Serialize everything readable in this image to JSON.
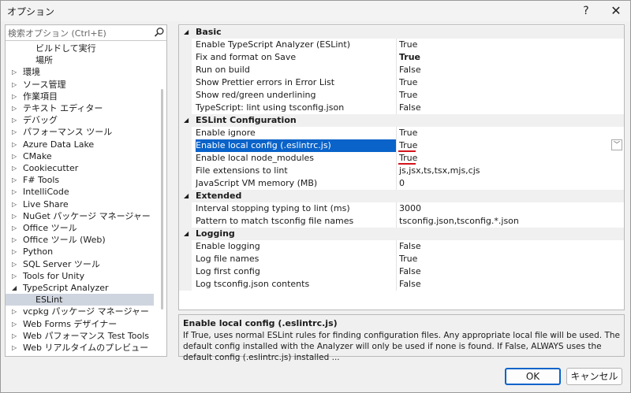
{
  "window": {
    "title": "オプション",
    "help_glyph": "?",
    "close_glyph": "✕"
  },
  "search": {
    "placeholder": "検索オプション (Ctrl+E)"
  },
  "tree": {
    "items": [
      {
        "label": "ビルドして実行",
        "level": 2,
        "expandable": false
      },
      {
        "label": "場所",
        "level": 2,
        "expandable": false
      },
      {
        "label": "環境",
        "level": 1,
        "expandable": true
      },
      {
        "label": "ソース管理",
        "level": 1,
        "expandable": true
      },
      {
        "label": "作業項目",
        "level": 1,
        "expandable": true
      },
      {
        "label": "テキスト エディター",
        "level": 1,
        "expandable": true
      },
      {
        "label": "デバッグ",
        "level": 1,
        "expandable": true
      },
      {
        "label": "パフォーマンス ツール",
        "level": 1,
        "expandable": true
      },
      {
        "label": "Azure Data Lake",
        "level": 1,
        "expandable": true
      },
      {
        "label": "CMake",
        "level": 1,
        "expandable": true
      },
      {
        "label": "Cookiecutter",
        "level": 1,
        "expandable": true
      },
      {
        "label": "F# Tools",
        "level": 1,
        "expandable": true
      },
      {
        "label": "IntelliCode",
        "level": 1,
        "expandable": true
      },
      {
        "label": "Live Share",
        "level": 1,
        "expandable": true
      },
      {
        "label": "NuGet パッケージ マネージャー",
        "level": 1,
        "expandable": true
      },
      {
        "label": "Office ツール",
        "level": 1,
        "expandable": true
      },
      {
        "label": "Office ツール (Web)",
        "level": 1,
        "expandable": true
      },
      {
        "label": "Python",
        "level": 1,
        "expandable": true
      },
      {
        "label": "SQL Server ツール",
        "level": 1,
        "expandable": true
      },
      {
        "label": "Tools for Unity",
        "level": 1,
        "expandable": true
      },
      {
        "label": "TypeScript Analyzer",
        "level": 1,
        "expandable": true,
        "expanded": true
      },
      {
        "label": "ESLint",
        "level": 2,
        "expandable": false,
        "selected": true
      },
      {
        "label": "vcpkg パッケージ マネージャー",
        "level": 1,
        "expandable": true
      },
      {
        "label": "Web Forms デザイナー",
        "level": 1,
        "expandable": true
      },
      {
        "label": "Web パフォーマンス Test Tools",
        "level": 1,
        "expandable": true
      },
      {
        "label": "Web リアルタイムのプレビュー",
        "level": 1,
        "expandable": true
      }
    ]
  },
  "properties": {
    "rows": [
      {
        "type": "category",
        "name": "Basic"
      },
      {
        "type": "prop",
        "name": "Enable TypeScript Analyzer (ESLint)",
        "value": "True"
      },
      {
        "type": "prop",
        "name": "Fix and format on Save",
        "value": "True",
        "bold": true
      },
      {
        "type": "prop",
        "name": "Run on build",
        "value": "False"
      },
      {
        "type": "prop",
        "name": "Show Prettier errors in Error List",
        "value": "True"
      },
      {
        "type": "prop",
        "name": "Show red/green underlining",
        "value": "True"
      },
      {
        "type": "prop",
        "name": "TypeScript: lint using tsconfig.json",
        "value": "False"
      },
      {
        "type": "category",
        "name": "ESLint Configuration"
      },
      {
        "type": "prop",
        "name": "Enable ignore",
        "value": "True"
      },
      {
        "type": "prop",
        "name": "Enable local config (.eslintrc.js)",
        "value": "True",
        "selected": true,
        "underline": true,
        "dropdown": true
      },
      {
        "type": "prop",
        "name": "Enable local node_modules",
        "value": "True",
        "underline": true
      },
      {
        "type": "prop",
        "name": "File extensions to lint",
        "value": "js,jsx,ts,tsx,mjs,cjs"
      },
      {
        "type": "prop",
        "name": "JavaScript VM memory (MB)",
        "value": "0"
      },
      {
        "type": "category",
        "name": "Extended"
      },
      {
        "type": "prop",
        "name": "Interval stopping typing to lint (ms)",
        "value": "3000"
      },
      {
        "type": "prop",
        "name": "Pattern to match tsconfig file names",
        "value": "tsconfig.json,tsconfig.*.json"
      },
      {
        "type": "category",
        "name": "Logging"
      },
      {
        "type": "prop",
        "name": "Enable logging",
        "value": "False"
      },
      {
        "type": "prop",
        "name": "Log file names",
        "value": "True"
      },
      {
        "type": "prop",
        "name": "Log first config",
        "value": "False"
      },
      {
        "type": "prop",
        "name": "Log tsconfig.json contents",
        "value": "False"
      }
    ]
  },
  "description": {
    "title": "Enable local config (.eslintrc.js)",
    "text": "If True, uses normal ESLint rules for finding configuration files. Any appropriate local file will be used. The default config installed with the Analyzer will only be used if none is found. If False, ALWAYS uses the default config (.eslintrc.js) installed ..."
  },
  "buttons": {
    "ok": "OK",
    "cancel": "キャンセル"
  },
  "colors": {
    "selection": "#0a63c9",
    "underline": "#d3141c",
    "tree_selection": "#cfd5df"
  }
}
